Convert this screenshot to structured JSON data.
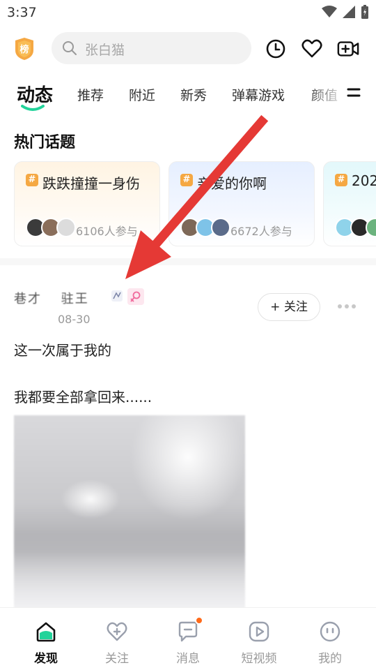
{
  "status_bar": {
    "time": "3:37"
  },
  "header": {
    "rank_label": "榜",
    "search_placeholder": "张白猫"
  },
  "tabs": [
    {
      "label": "动态",
      "active": true
    },
    {
      "label": "推荐"
    },
    {
      "label": "附近"
    },
    {
      "label": "新秀"
    },
    {
      "label": "弹幕游戏"
    },
    {
      "label": "颜值"
    }
  ],
  "hot_topics": {
    "title": "热门话题",
    "cards": [
      {
        "title": "跌跌撞撞一身伤",
        "participants": "6106人参与"
      },
      {
        "title": "亲爱的你啊",
        "participants": "6672人参与"
      },
      {
        "title": "202",
        "participants": ""
      }
    ]
  },
  "post": {
    "author": "巷才 　驻王",
    "date": "08-30",
    "follow_label": "+ 关注",
    "lines": [
      "这一次属于我的",
      "我都要全部拿回来......"
    ]
  },
  "bottom_nav": [
    {
      "label": "发现",
      "icon": "home-icon",
      "active": true
    },
    {
      "label": "关注",
      "icon": "heart-plus-icon"
    },
    {
      "label": "消息",
      "icon": "message-icon",
      "badge": true
    },
    {
      "label": "短视频",
      "icon": "play-icon"
    },
    {
      "label": "我的",
      "icon": "profile-icon"
    }
  ],
  "colors": {
    "accent_green": "#22d39a",
    "arrow_red": "#e53935",
    "badge_orange": "#f5a843",
    "notify_orange": "#ff6a1a"
  }
}
